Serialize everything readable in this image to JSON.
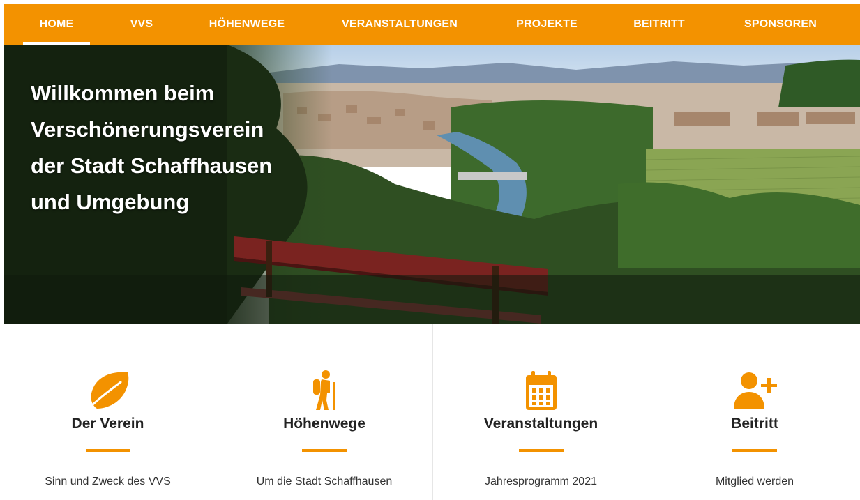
{
  "nav": {
    "items": [
      {
        "label": "HOME",
        "active": true
      },
      {
        "label": "VVS"
      },
      {
        "label": "HÖHENWEGE"
      },
      {
        "label": "VERANSTALTUNGEN"
      },
      {
        "label": "PROJEKTE"
      },
      {
        "label": "BEITRITT"
      },
      {
        "label": "SPONSOREN"
      }
    ]
  },
  "hero": {
    "title": "Willkommen beim Verschönerungsverein der Stadt Schaffhausen und Umgebung"
  },
  "cards": [
    {
      "icon": "leaf-icon",
      "title": "Der Verein",
      "subtitle": "Sinn und Zweck des VVS"
    },
    {
      "icon": "hiker-icon",
      "title": "Höhenwege",
      "subtitle": "Um die Stadt Schaffhausen"
    },
    {
      "icon": "calendar-icon",
      "title": "Veranstaltungen",
      "subtitle": "Jahresprogramm 2021"
    },
    {
      "icon": "user-plus-icon",
      "title": "Beitritt",
      "subtitle": "Mitglied werden"
    }
  ],
  "colors": {
    "accent": "#f39200",
    "text": "#222222"
  }
}
